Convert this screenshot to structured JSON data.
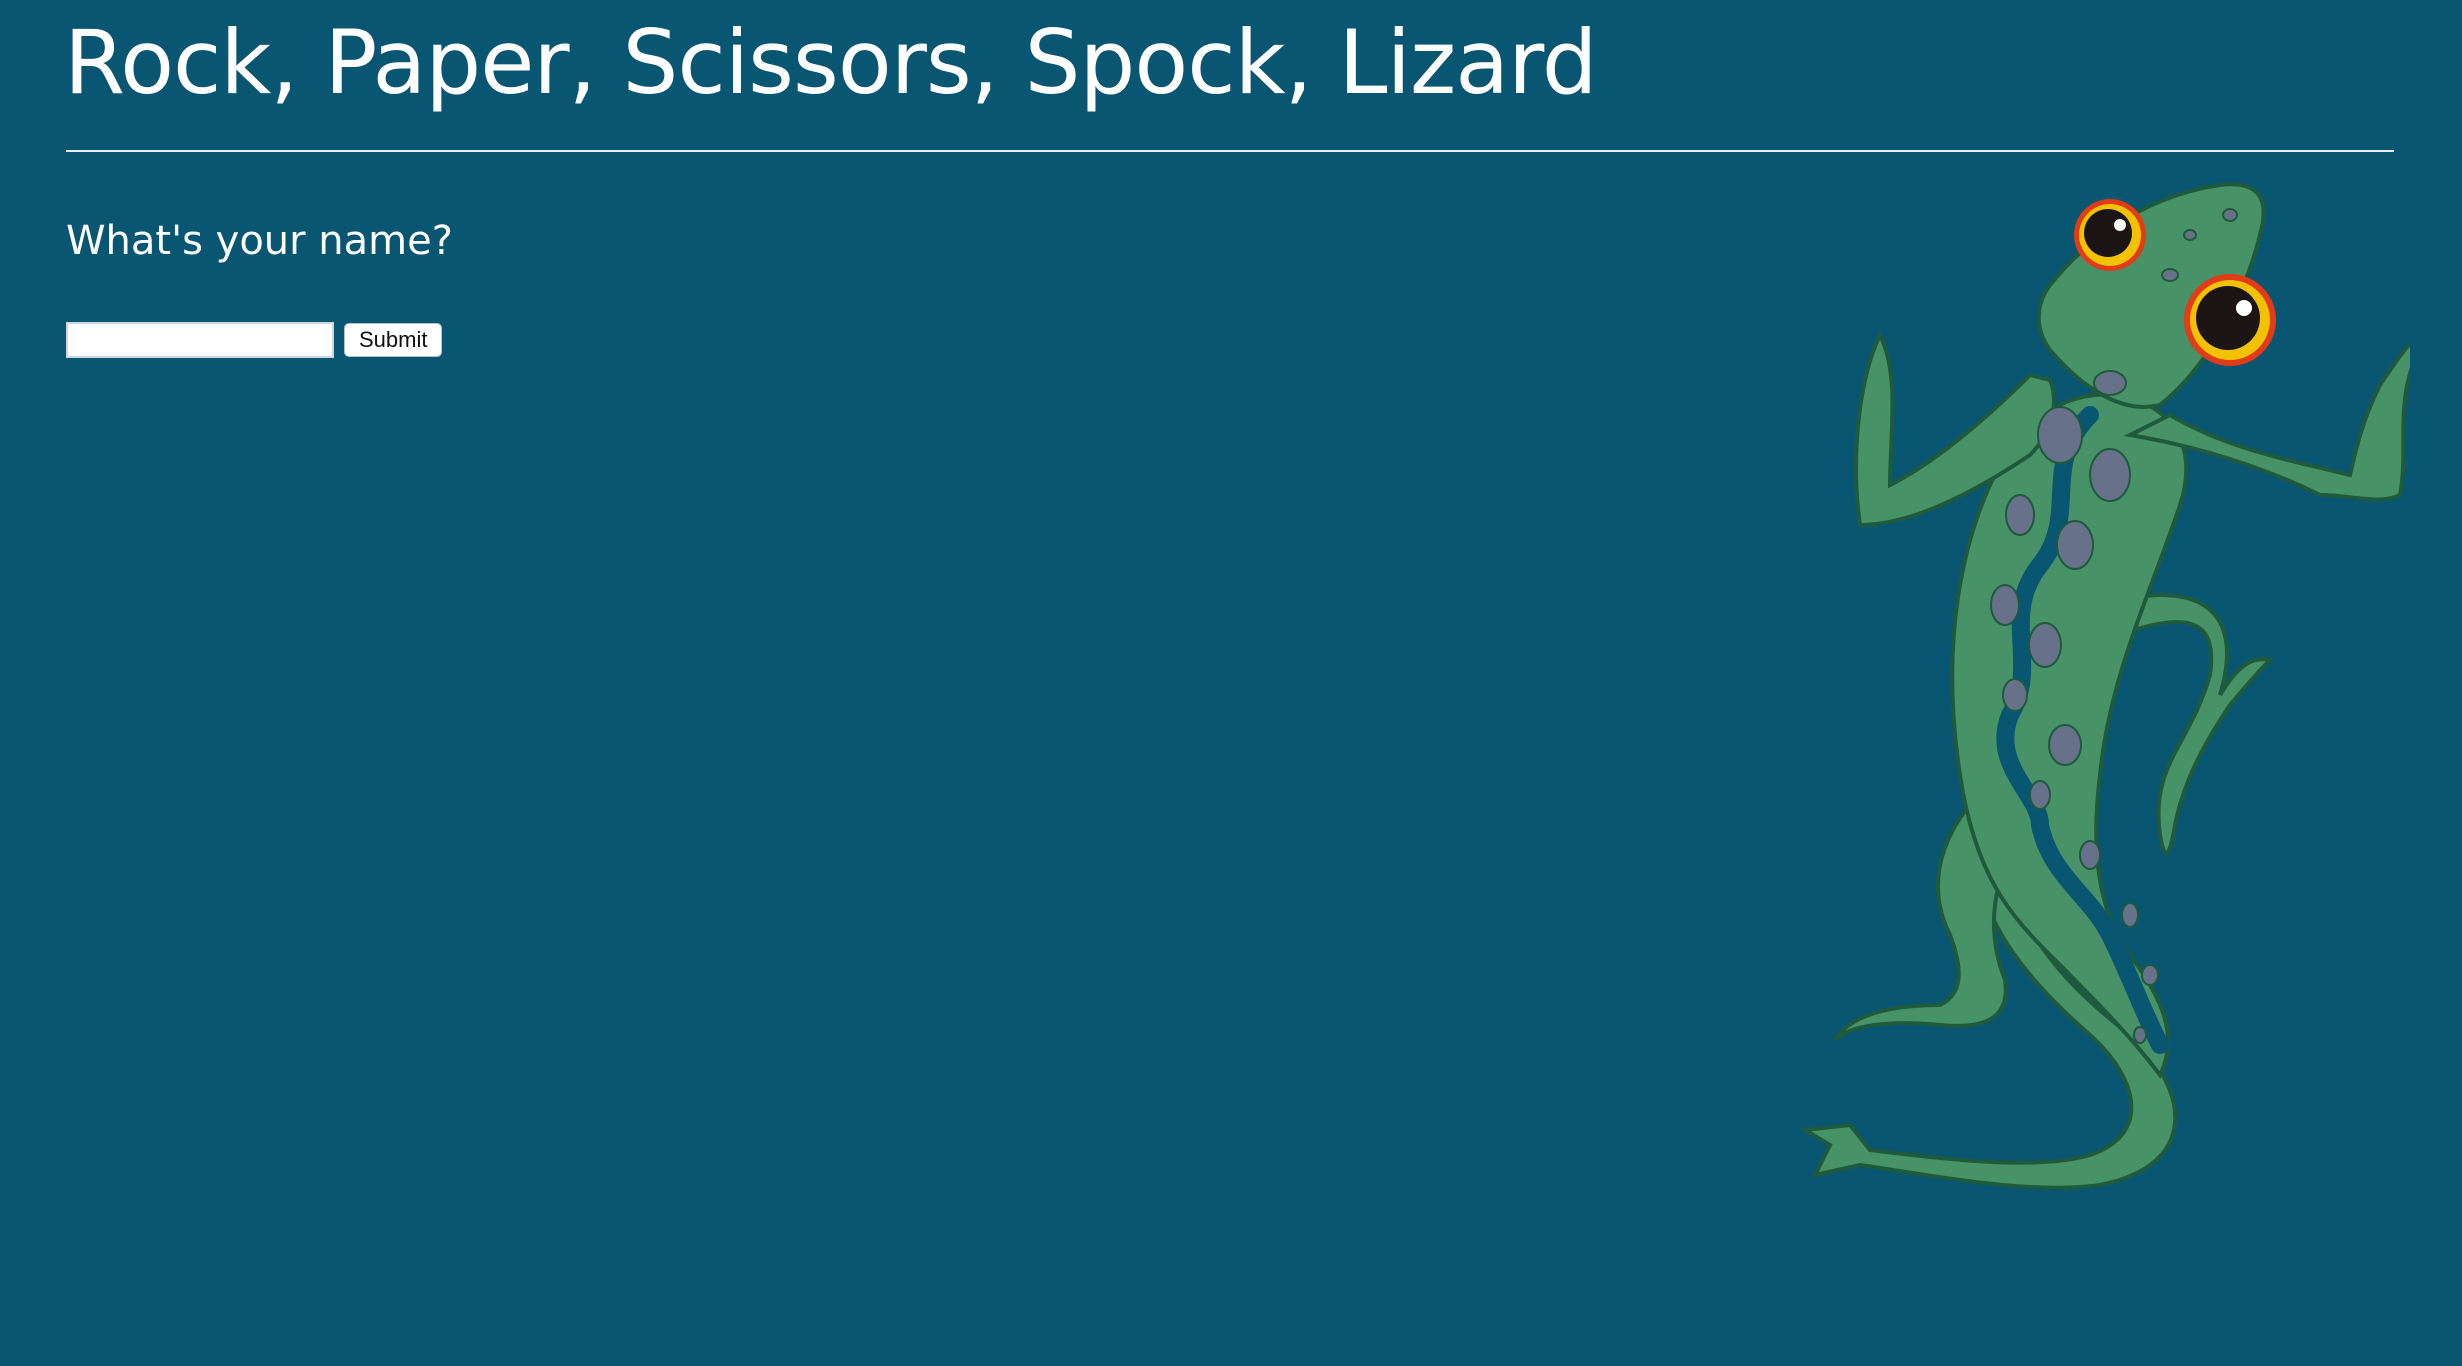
{
  "header": {
    "title": "Rock, Paper, Scissors, Spock, Lizard"
  },
  "form": {
    "question": "What's your name?",
    "input_value": "",
    "input_placeholder": "",
    "submit_label": "Submit"
  },
  "colors": {
    "background": "#085672",
    "lizard_body": "#479266",
    "lizard_outline": "#1e5a3b",
    "lizard_spots": "#67728a",
    "eye_ring": "#f2c200",
    "eye_rim": "#e23b17",
    "pupil": "#1b1615"
  },
  "illustration": {
    "icon": "lizard-icon"
  }
}
